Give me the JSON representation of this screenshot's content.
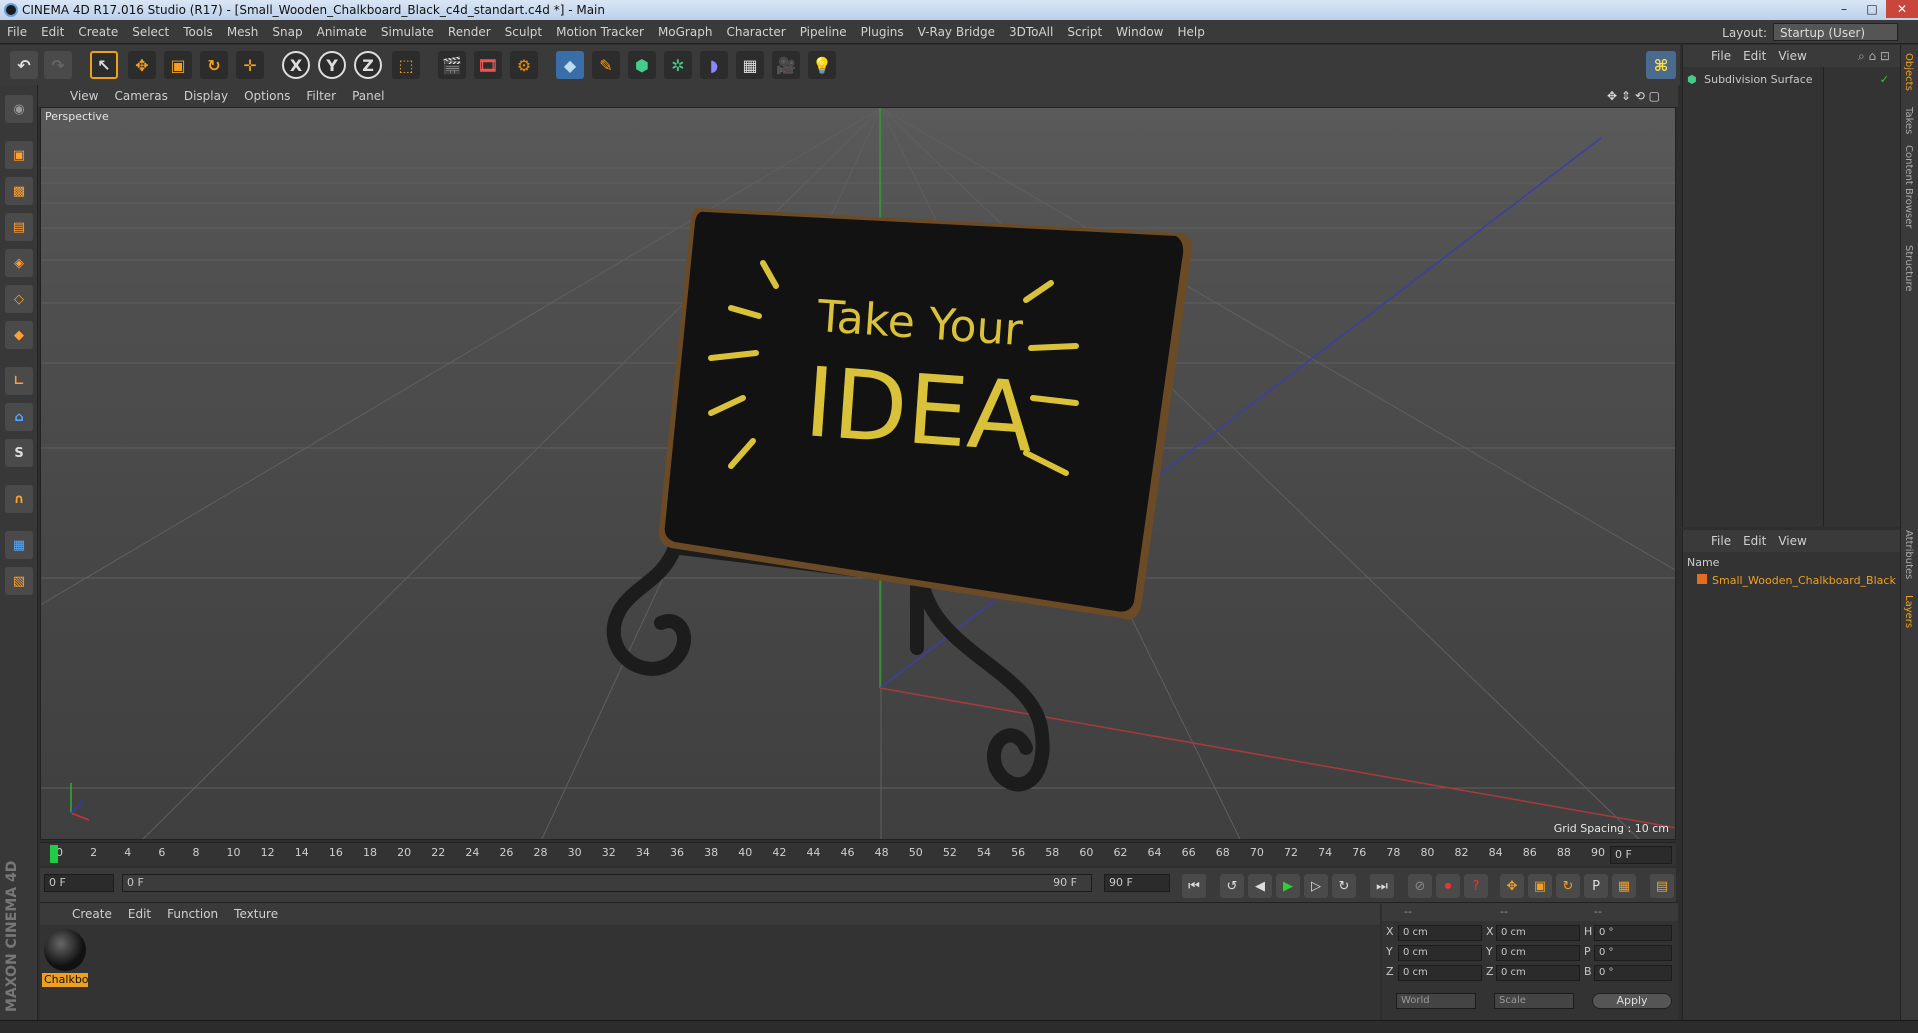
{
  "window": {
    "title": "CINEMA 4D R17.016 Studio (R17) - [Small_Wooden_Chalkboard_Black_c4d_standart.c4d *] - Main",
    "controls": [
      "–",
      "□",
      "✕"
    ]
  },
  "menubar": {
    "items": [
      "File",
      "Edit",
      "Create",
      "Select",
      "Tools",
      "Mesh",
      "Snap",
      "Animate",
      "Simulate",
      "Render",
      "Sculpt",
      "Motion Tracker",
      "MoGraph",
      "Character",
      "Pipeline",
      "Plugins",
      "V-Ray Bridge",
      "3DToAll",
      "Script",
      "Window",
      "Help"
    ],
    "layout_label": "Layout:",
    "layout_value": "Startup (User)"
  },
  "toolbar": {
    "axis_x": "X",
    "axis_y": "Y",
    "axis_z": "Z"
  },
  "viewport": {
    "menu": [
      "View",
      "Cameras",
      "Display",
      "Options",
      "Filter",
      "Panel"
    ],
    "label": "Perspective",
    "grid_spacing": "Grid Spacing : 10 cm",
    "board_text_line1": "Take Your",
    "board_text_line2": "IDEA"
  },
  "timeline": {
    "ticks": [
      "0",
      "2",
      "4",
      "6",
      "8",
      "10",
      "12",
      "14",
      "16",
      "18",
      "20",
      "22",
      "24",
      "26",
      "28",
      "30",
      "32",
      "34",
      "36",
      "38",
      "40",
      "42",
      "44",
      "46",
      "48",
      "50",
      "52",
      "54",
      "56",
      "58",
      "60",
      "62",
      "64",
      "66",
      "68",
      "70",
      "72",
      "74",
      "76",
      "78",
      "80",
      "82",
      "84",
      "86",
      "88",
      "90"
    ],
    "frame_field": "0 F",
    "start_field": "0 F",
    "range_start": "0 F",
    "range_end": "90 F",
    "end_field": "90 F"
  },
  "material_panel": {
    "menu": [
      "Create",
      "Edit",
      "Function",
      "Texture"
    ],
    "material_name": "Chalkbo"
  },
  "coords": {
    "header": [
      "--",
      "--",
      "--"
    ],
    "rows": [
      {
        "a": "X",
        "av": "0 cm",
        "b": "X",
        "bv": "0 cm",
        "c": "H",
        "cv": "0 °"
      },
      {
        "a": "Y",
        "av": "0 cm",
        "b": "Y",
        "bv": "0 cm",
        "c": "P",
        "cv": "0 °"
      },
      {
        "a": "Z",
        "av": "0 cm",
        "b": "Z",
        "bv": "0 cm",
        "c": "B",
        "cv": "0 °"
      }
    ],
    "space": "World",
    "mode": "Scale",
    "apply": "Apply"
  },
  "object_panel": {
    "menu": [
      "File",
      "Edit",
      "View"
    ],
    "item": "Subdivision Surface"
  },
  "layer_panel": {
    "menu": [
      "File",
      "Edit",
      "View"
    ],
    "column": "Name",
    "item": "Small_Wooden_Chalkboard_Black"
  },
  "side_tabs": [
    "Objects",
    "Takes",
    "Content Browser",
    "Structure",
    "Attributes",
    "Layers"
  ],
  "branding": "MAXON CINEMA 4D",
  "colors": {
    "accent": "#f0a020",
    "timeline_marker": "#22cc44"
  }
}
